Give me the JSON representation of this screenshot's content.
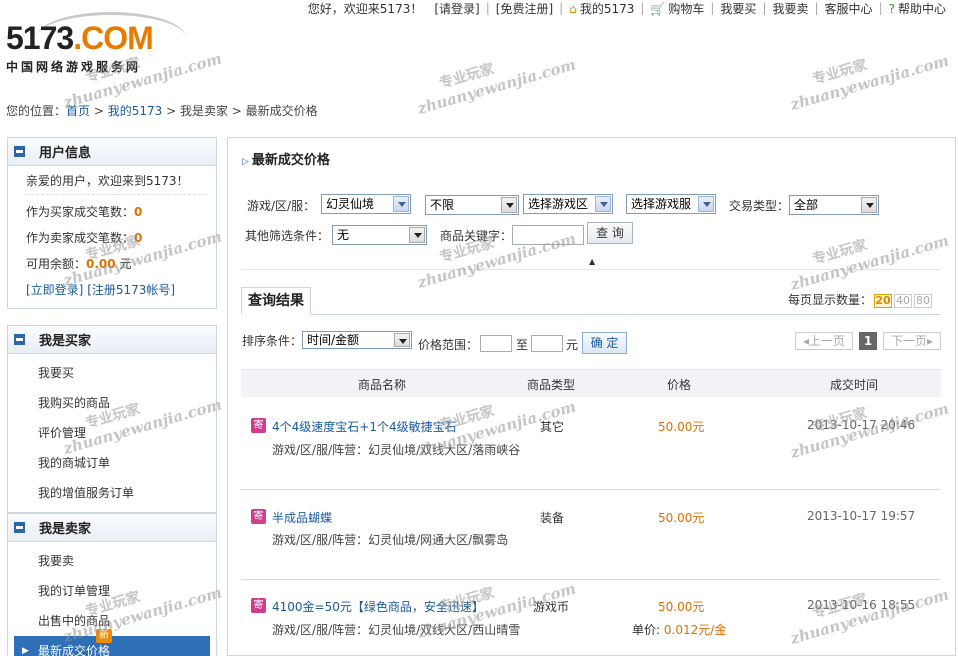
{
  "topnav": {
    "greeting": "您好，欢迎来5173！",
    "login": "[请登录]",
    "register": "[免费注册]",
    "my5173": "我的5173",
    "cart": "购物车",
    "buy": "我要买",
    "sell": "我要卖",
    "service": "客服中心",
    "help": "帮助中心"
  },
  "logo": {
    "brand_a": "5173",
    "brand_b": ".COM",
    "tagline": "中国网络游戏服务网"
  },
  "breadcrumb": {
    "prefix": "您的位置：",
    "home": "首页",
    "my": "我的5173",
    "seller": "我是卖家",
    "current": "最新成交价格"
  },
  "user_panel": {
    "title": "用户信息",
    "welcome": "亲爱的用户，欢迎来到5173！",
    "buyer_count_label": "作为买家成交笔数：",
    "buyer_count": "0",
    "seller_count_label": "作为卖家成交笔数：",
    "seller_count": "0",
    "balance_label": "可用余额：",
    "balance": "0.00",
    "balance_unit": "元",
    "login_link": "[立即登录]",
    "register_link": "[注册5173帐号]"
  },
  "buyer_panel": {
    "title": "我是买家",
    "items": [
      "我要买",
      "我购买的商品",
      "评价管理",
      "我的商城订单",
      "我的增值服务订单"
    ]
  },
  "seller_panel": {
    "title": "我是卖家",
    "items": [
      "我要卖",
      "我的订单管理",
      "出售中的商品",
      "最新成交价格"
    ],
    "new_badge": "新"
  },
  "main": {
    "title": "最新成交价格",
    "filters": {
      "game_label": "游戏/区/服：",
      "game": "幻灵仙境",
      "unlimited": "不限",
      "area": "选择游戏区",
      "server": "选择游戏服",
      "trade_type_label": "交易类型：",
      "trade_type": "全部",
      "other_label": "其他筛选条件：",
      "other": "无",
      "keyword_label": "商品关键字：",
      "search_button": "查 询"
    },
    "results": {
      "tab": "查询结果",
      "per_page_label": "每页显示数量：",
      "per_page_options": [
        "20",
        "40",
        "80"
      ],
      "sort_label": "排序条件：",
      "sort_value": "时间/金额",
      "price_range_label": "价格范围：",
      "to": "至",
      "unit": "元",
      "confirm": "确 定",
      "prev": "上一页",
      "page": "1",
      "next": "下一页"
    },
    "columns": [
      "商品名称",
      "商品类型",
      "价格",
      "成交时间"
    ],
    "rows": [
      {
        "tag": "寄",
        "name": "4个4级速度宝石+1个4级敏捷宝石",
        "server": "游戏/区/服/阵营：幻灵仙境/双线大区/落雨峡谷",
        "type": "其它",
        "price": "50.00元",
        "time": "2013-10-17 20:46",
        "unit_price": ""
      },
      {
        "tag": "寄",
        "name": "半成品蝴蝶",
        "server": "游戏/区/服/阵营：幻灵仙境/网通大区/飘雾岛",
        "type": "装备",
        "price": "50.00元",
        "time": "2013-10-17 19:57",
        "unit_price": ""
      },
      {
        "tag": "寄",
        "name": "4100金=50元【绿色商品，安全迅速】",
        "server": "游戏/区/服/阵营：幻灵仙境/双线大区/西山晴雪",
        "type": "游戏币",
        "price": "50.00元",
        "time": "2013-10-16 18:55",
        "unit_price_label": "单价:",
        "unit_price": "0.012元/金"
      }
    ]
  },
  "watermark": {
    "cn": "专业玩家",
    "en": "zhuanyewanjia.com"
  }
}
